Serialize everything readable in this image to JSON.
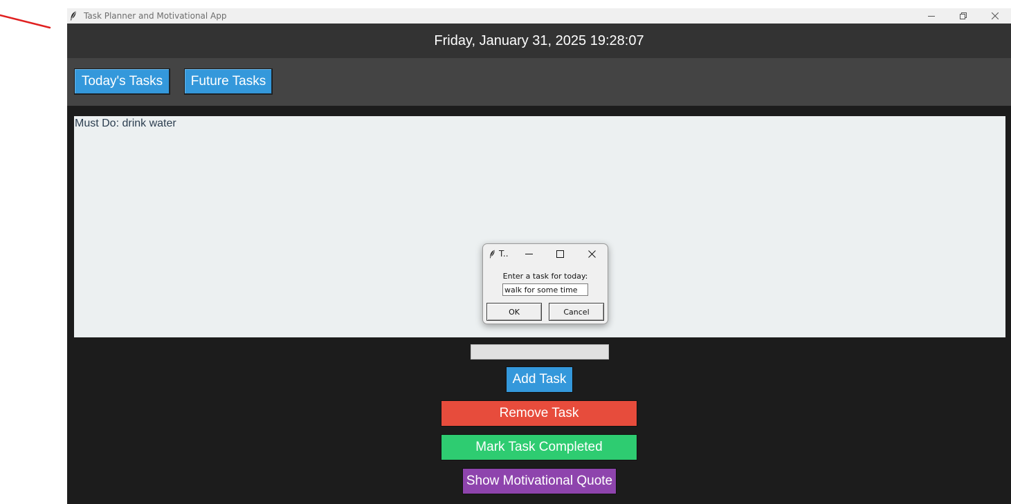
{
  "window": {
    "title": "Task Planner and Motivational App"
  },
  "header": {
    "datetime": "Friday, January 31, 2025 19:28:07"
  },
  "tabs": [
    {
      "label": "Today's Tasks"
    },
    {
      "label": "Future Tasks"
    }
  ],
  "task_list": {
    "items": [
      "Must Do: drink water"
    ]
  },
  "task_entry": {
    "value": ""
  },
  "actions": {
    "add": "Add Task",
    "remove": "Remove Task",
    "complete": "Mark Task Completed",
    "quote": "Show Motivational Quote"
  },
  "dialog": {
    "title": "T..",
    "prompt": "Enter a task for today:",
    "input_value": "walk for some time",
    "ok": "OK",
    "cancel": "Cancel"
  },
  "colors": {
    "header_bg": "#333333",
    "tabbar_bg": "#444444",
    "window_bg": "#1c1c1c",
    "list_bg": "#ecf0f1",
    "blue": "#3498db",
    "red": "#e74c3c",
    "green": "#2ecc71",
    "purple": "#8e44ad"
  },
  "icons": {
    "app": "feather-icon",
    "minimize": "minimize-icon",
    "restore": "restore-icon",
    "close": "close-icon"
  }
}
